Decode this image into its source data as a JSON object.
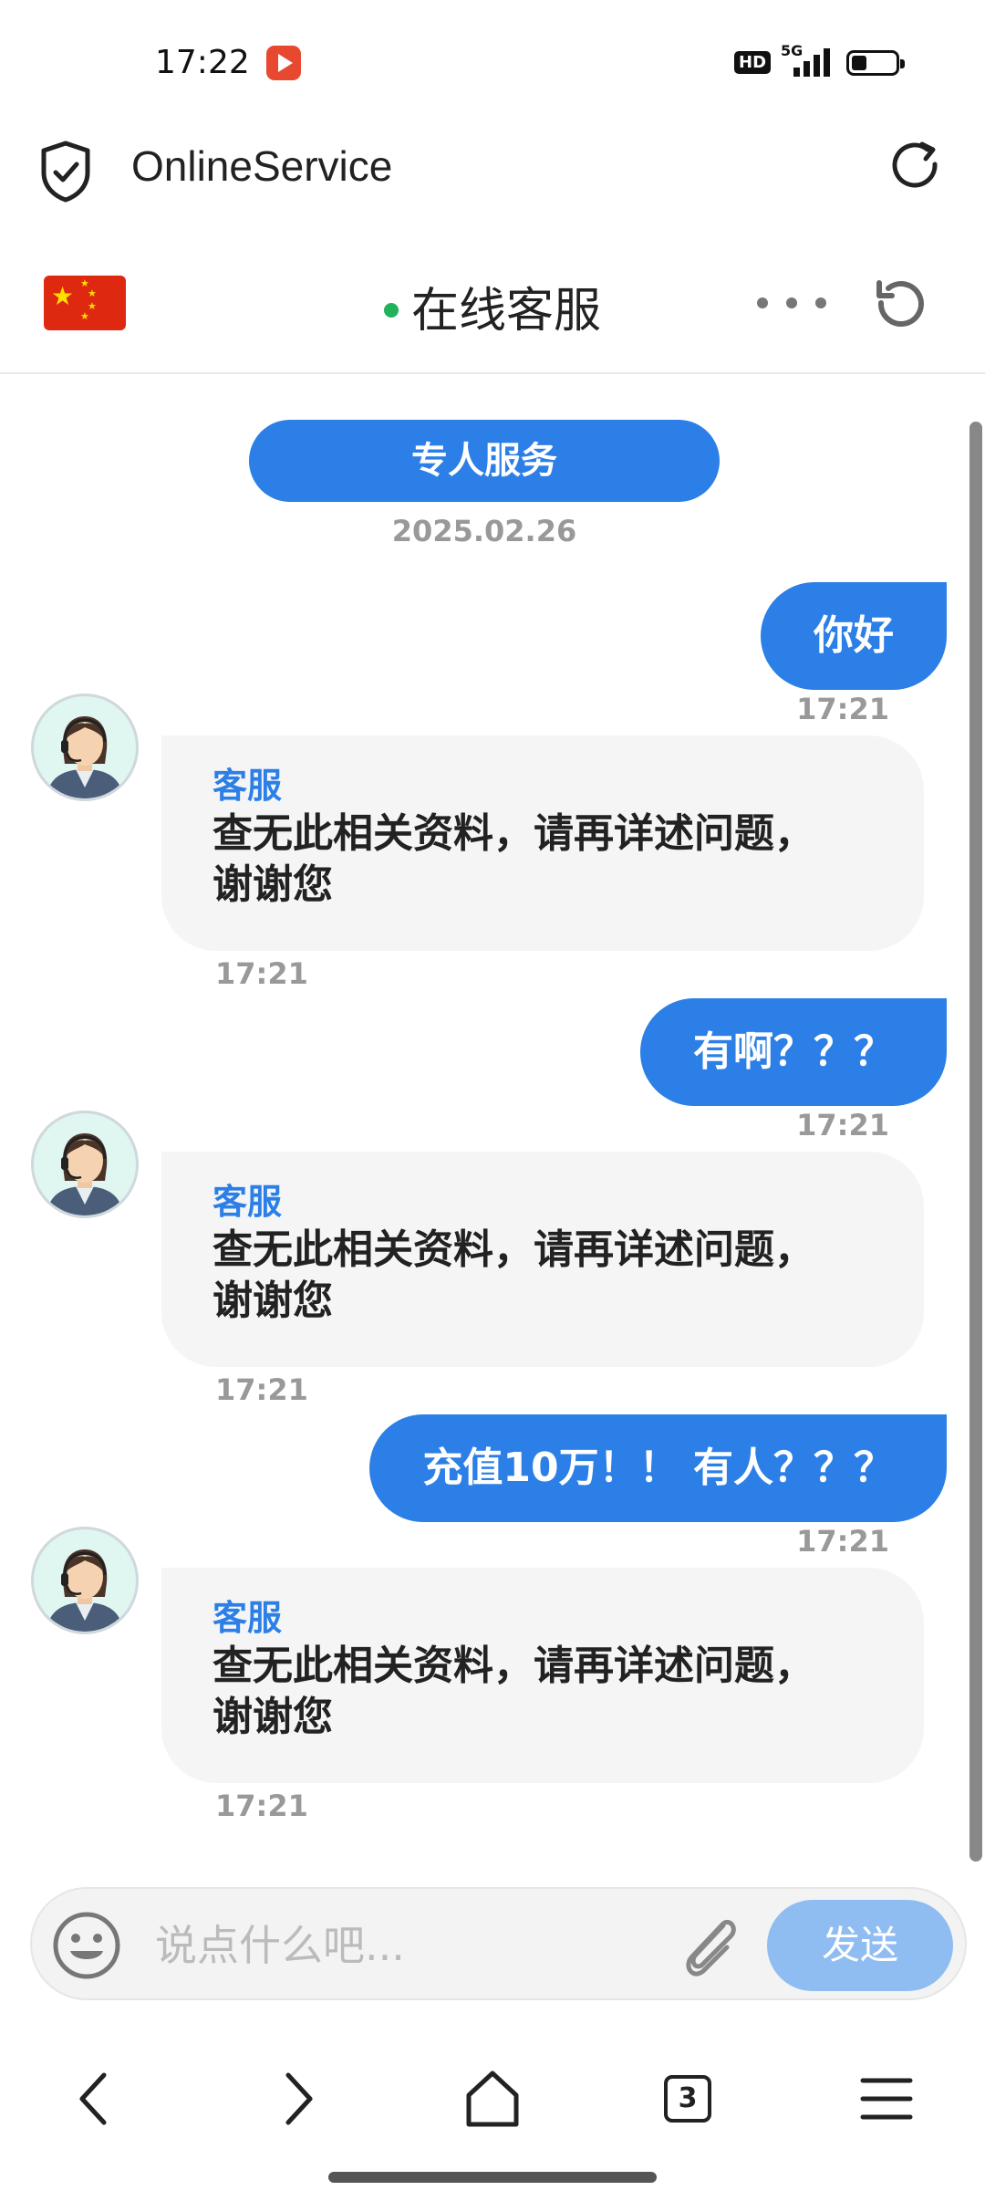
{
  "status_bar": {
    "time": "17:22",
    "hd": "HD",
    "network": "5G",
    "battery_level": 0.35
  },
  "browser": {
    "site_title": "OnlineService"
  },
  "chat_header": {
    "title": "在线客服",
    "status_color": "#21b25b"
  },
  "chat": {
    "service_label": "专人服务",
    "date": "2025.02.26",
    "messages": [
      {
        "from": "user",
        "text": "你好",
        "time": "17:21"
      },
      {
        "from": "agent",
        "name": "客服",
        "line1": "查无此相关资料，请再详述问题，",
        "line2": "谢谢您",
        "time": "17:21"
      },
      {
        "from": "user",
        "text": "有啊？？？",
        "time": "17:21"
      },
      {
        "from": "agent",
        "name": "客服",
        "line1": "查无此相关资料，请再详述问题，",
        "line2": "谢谢您",
        "time": "17:21"
      },
      {
        "from": "user",
        "text": "充值10万！！ 有人？？？",
        "time": "17:21"
      },
      {
        "from": "agent",
        "name": "客服",
        "line1": "查无此相关资料，请再详述问题，",
        "line2": "谢谢您",
        "time": "17:21"
      }
    ]
  },
  "input": {
    "placeholder": "说点什么吧...",
    "send_label": "发送"
  },
  "nav": {
    "tab_count": "3"
  },
  "colors": {
    "accent": "#2b7fe6",
    "send_disabled": "#8fbdf1"
  }
}
